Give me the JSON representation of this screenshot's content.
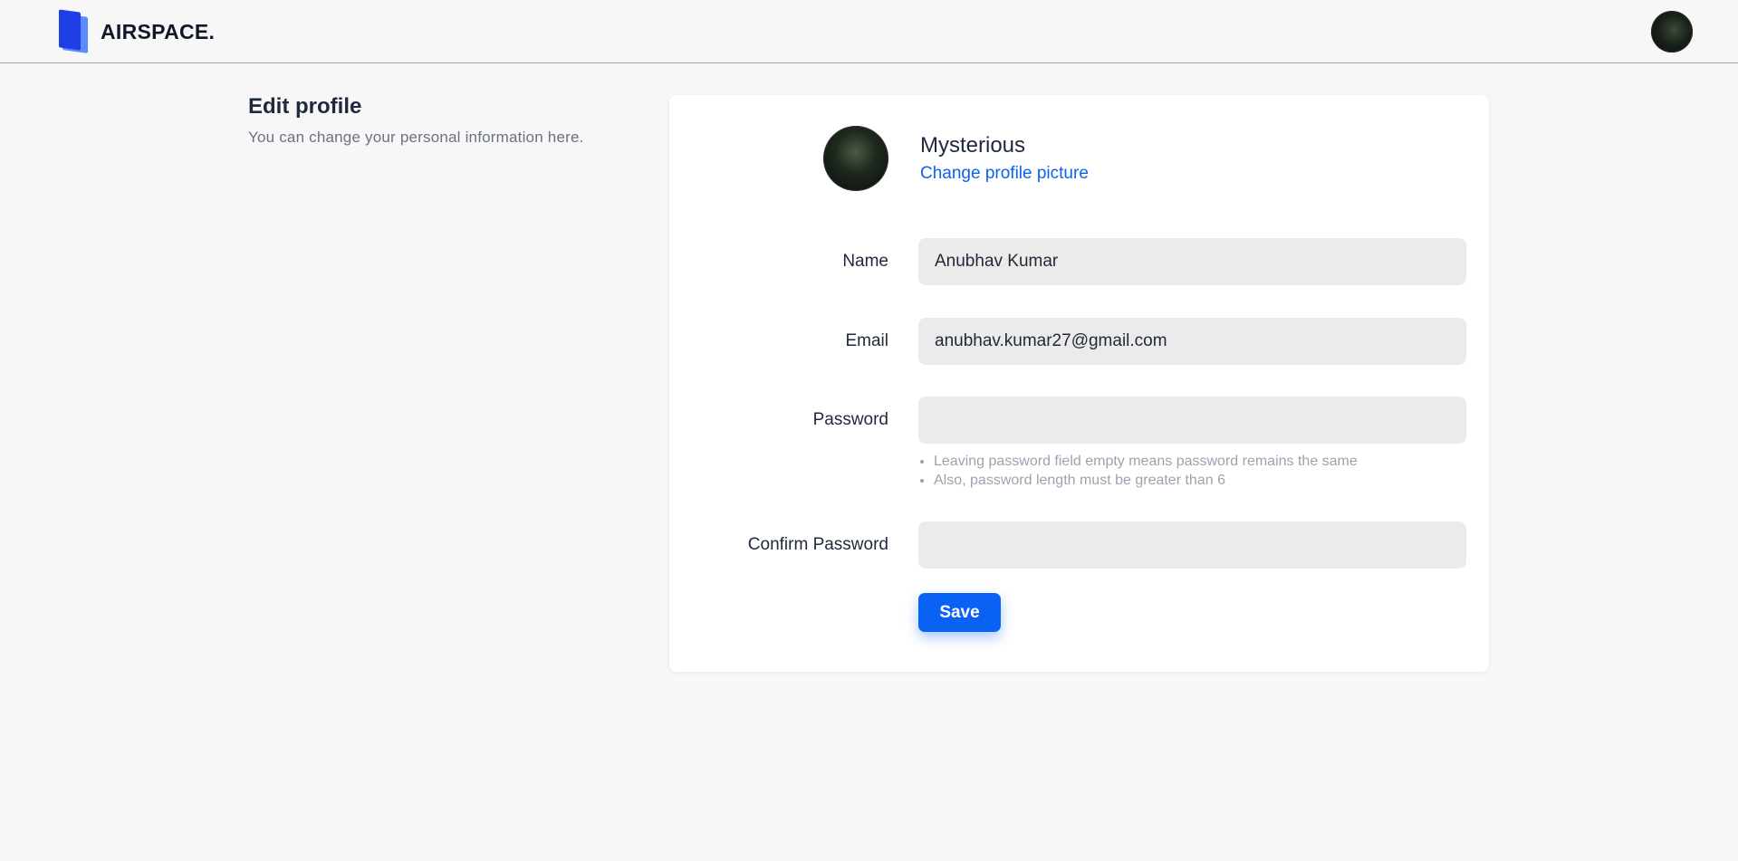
{
  "brand": {
    "name": "AIRSPACE."
  },
  "intro": {
    "title": "Edit profile",
    "subtitle": "You can change your personal information here."
  },
  "profile": {
    "display_name": "Mysterious",
    "change_picture_label": "Change profile picture"
  },
  "form": {
    "name": {
      "label": "Name",
      "value": "Anubhav Kumar"
    },
    "email": {
      "label": "Email",
      "value": "anubhav.kumar27@gmail.com"
    },
    "password": {
      "label": "Password",
      "value": "",
      "hints": [
        "Leaving password field empty means password remains the same",
        "Also, password length must be greater than 6"
      ]
    },
    "confirm_password": {
      "label": "Confirm Password",
      "value": ""
    },
    "save_label": "Save"
  },
  "colors": {
    "accent": "#0a62f5",
    "link": "#0b63e5",
    "background": "#f7f7f7",
    "field_bg": "#ebebeb"
  },
  "icons": {
    "brand_logo": "airspace-logo-icon",
    "nav_avatar": "user-avatar",
    "profile_avatar": "profile-avatar"
  }
}
